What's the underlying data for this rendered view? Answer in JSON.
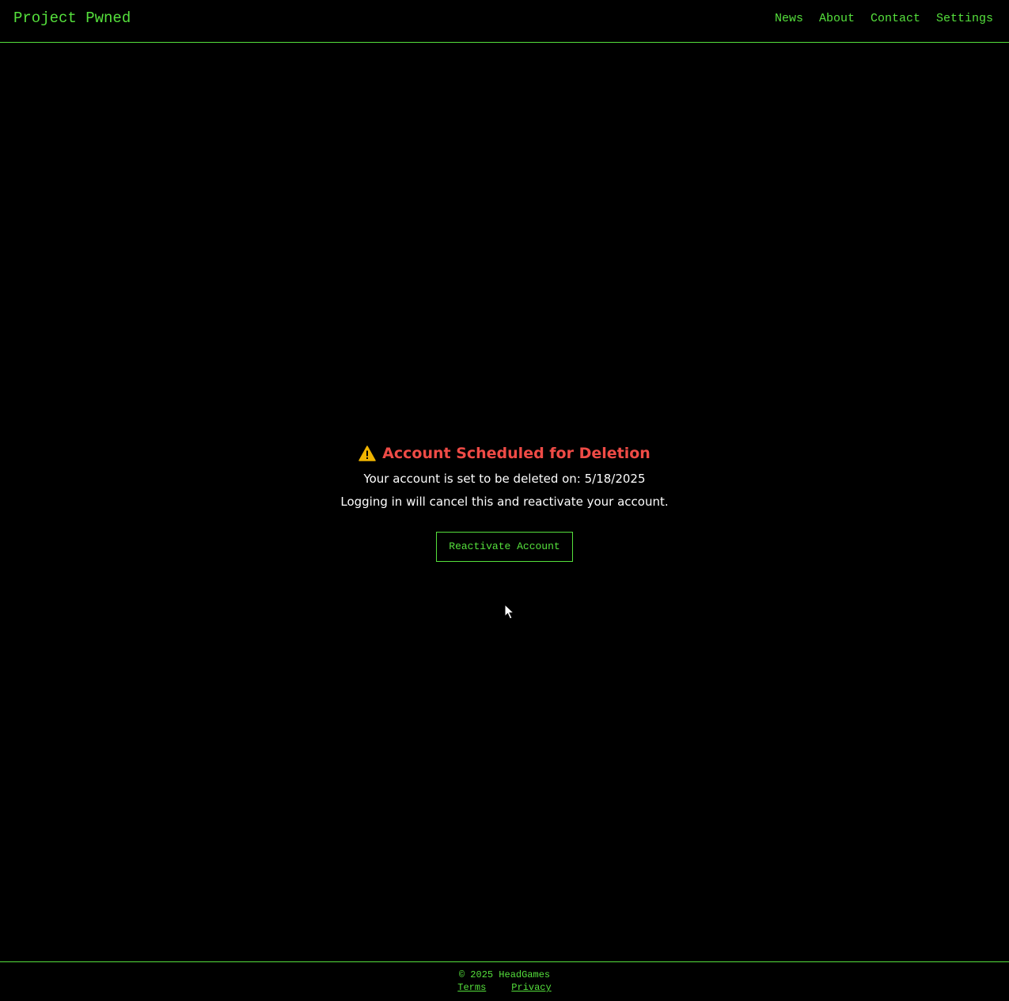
{
  "header": {
    "brand": "Project Pwned",
    "nav": [
      {
        "label": "News"
      },
      {
        "label": "About"
      },
      {
        "label": "Contact"
      },
      {
        "label": "Settings"
      }
    ]
  },
  "notice": {
    "icon": "warning-icon",
    "title": "Account Scheduled for Deletion",
    "line1": "Your account is set to be deleted on: 5/18/2025",
    "line2": "Logging in will cancel this and reactivate your account.",
    "button_label": "Reactivate Account"
  },
  "footer": {
    "copyright": "© 2025 HeadGames",
    "links": [
      {
        "label": "Terms"
      },
      {
        "label": "Privacy"
      }
    ]
  },
  "colors": {
    "background": "#000000",
    "accent": "#55e03c",
    "alert": "#ef4b46",
    "warning_icon": "#f0b400",
    "text": "#ffffff"
  }
}
